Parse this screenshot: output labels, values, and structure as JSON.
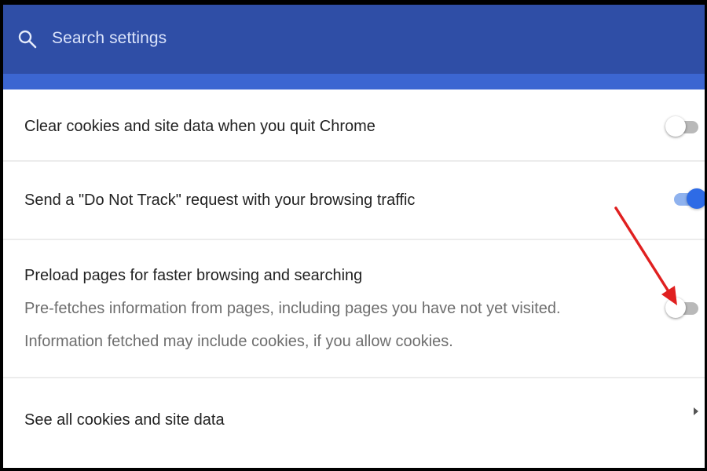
{
  "search": {
    "placeholder": "Search settings",
    "icon": "search-icon"
  },
  "colors": {
    "header": "#2f4ea6",
    "header_strip": "#3c66d1",
    "toggle_on": "#2e6be6",
    "annotation_arrow": "#e02020"
  },
  "settings": [
    {
      "label": "Clear cookies and site data when you quit Chrome",
      "toggle": "off"
    },
    {
      "label": "Send a \"Do Not Track\" request with your browsing traffic",
      "toggle": "on"
    },
    {
      "label": "Preload pages for faster browsing and searching",
      "description": "Pre-fetches information from pages, including pages you have not yet visited. Information fetched may include cookies, if you allow cookies.",
      "toggle": "off"
    },
    {
      "label": "See all cookies and site data",
      "icon": "chevron-right-icon"
    }
  ]
}
